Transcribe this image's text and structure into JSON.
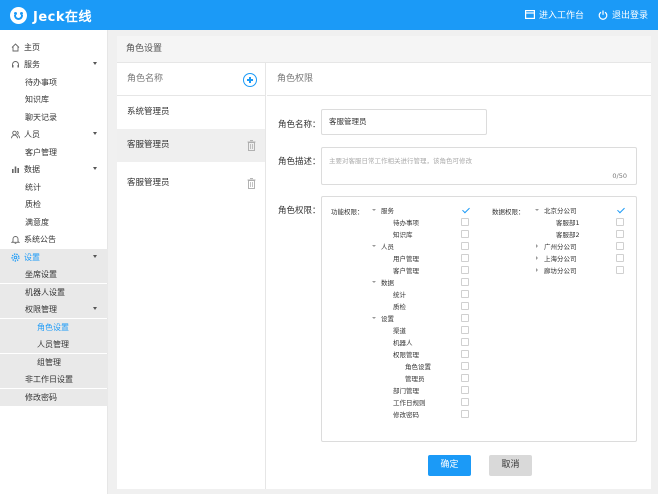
{
  "app": {
    "brand": "Jeck在线"
  },
  "header": {
    "workbench_label": "进入工作台",
    "logout_label": "退出登录"
  },
  "sidebar": {
    "items": [
      {
        "label": "主页",
        "icon": "home-icon"
      },
      {
        "label": "服务",
        "icon": "headset-icon"
      },
      {
        "label": "待办事项"
      },
      {
        "label": "知识库"
      },
      {
        "label": "聊天记录"
      },
      {
        "label": "人员",
        "icon": "users-icon"
      },
      {
        "label": "客户管理"
      },
      {
        "label": "数据",
        "icon": "bar-chart-icon"
      },
      {
        "label": "统计"
      },
      {
        "label": "质检"
      },
      {
        "label": "满意度"
      },
      {
        "label": "系统公告",
        "icon": "bell-icon"
      },
      {
        "label": "设置",
        "icon": "gear-icon"
      },
      {
        "label": "坐席设置"
      },
      {
        "label": "机器人设置"
      },
      {
        "label": "权限管理"
      },
      {
        "label": "角色设置"
      },
      {
        "label": "人员管理"
      },
      {
        "label": "组管理"
      },
      {
        "label": "非工作日设置"
      },
      {
        "label": "修改密码"
      }
    ]
  },
  "main": {
    "title": "角色设置",
    "roles": {
      "header": "角色名称",
      "items": [
        "系统管理员",
        "客服管理员",
        "客服管理员"
      ]
    },
    "permissions": {
      "header": "角色权限",
      "name_label": "角色名称：",
      "name_value": "客服管理员",
      "desc_label": "角色描述：",
      "desc_placeholder": "主要对客服日常工作相关进行管理，该角色可修改",
      "desc_count": "0/50",
      "perm_label": "角色权限：",
      "func_label": "功能权限：",
      "data_label": "数据权限：",
      "func_tree": [
        {
          "label": "服务",
          "checked": true
        },
        {
          "label": "待办事项",
          "checked": false
        },
        {
          "label": "知识库",
          "checked": false
        },
        {
          "label": "人员",
          "checked": false
        },
        {
          "label": "用户管理",
          "checked": false
        },
        {
          "label": "客户管理",
          "checked": false
        },
        {
          "label": "数据",
          "checked": false
        },
        {
          "label": "统计",
          "checked": false
        },
        {
          "label": "质检",
          "checked": false
        },
        {
          "label": "设置",
          "checked": false
        },
        {
          "label": "渠道",
          "checked": false
        },
        {
          "label": "机器人",
          "checked": false
        },
        {
          "label": "权限管理",
          "checked": false
        },
        {
          "label": "角色设置",
          "checked": false
        },
        {
          "label": "管理员",
          "checked": false
        },
        {
          "label": "部门管理",
          "checked": false
        },
        {
          "label": "工作日规则",
          "checked": false
        },
        {
          "label": "修改密码",
          "checked": false
        }
      ],
      "data_tree": [
        {
          "label": "北京分公司",
          "checked": true
        },
        {
          "label": "客服部1",
          "checked": false
        },
        {
          "label": "客服部2",
          "checked": false
        },
        {
          "label": "广州分公司",
          "checked": false
        },
        {
          "label": "上海分公司",
          "checked": false
        },
        {
          "label": "廊坊分公司",
          "checked": false
        }
      ]
    },
    "confirm_label": "确定",
    "cancel_label": "取消"
  },
  "colors": {
    "accent": "#1b9af7",
    "active_bg": "#e9e9e9"
  }
}
